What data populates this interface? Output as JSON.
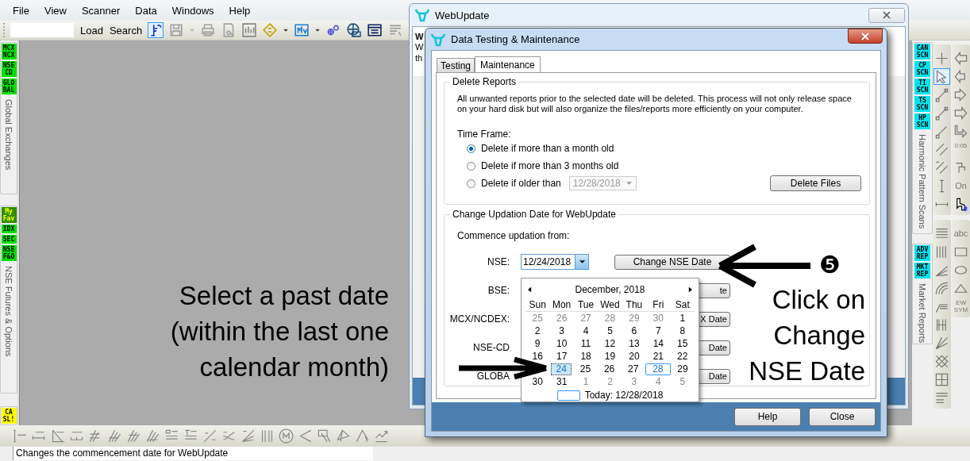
{
  "menu": [
    "File",
    "View",
    "Scanner",
    "Data",
    "Windows",
    "Help"
  ],
  "toolbar": {
    "buttons": [
      "Load",
      "Search"
    ]
  },
  "left_panels": [
    {
      "title": "Global Exchanges",
      "badges": [
        {
          "lines": [
            "MCX",
            "NCX"
          ],
          "color": "#00e000"
        },
        {
          "lines": [
            "NSE",
            "CD"
          ],
          "color": "#00e000"
        },
        {
          "lines": [
            "GLO",
            "BAL"
          ],
          "color": "#00e000"
        }
      ]
    },
    {
      "title": "NSE Futures & Options",
      "badges": [
        {
          "lines": [
            "My",
            "Fav"
          ],
          "color": "#2f8f00"
        },
        {
          "lines": [
            "IDX"
          ],
          "color": "#00e000"
        },
        {
          "lines": [
            "SEC"
          ],
          "color": "#00e000"
        },
        {
          "lines": [
            "NSE",
            "F&O"
          ],
          "color": "#00e000"
        }
      ]
    },
    {
      "badges": [
        {
          "lines": [
            "CA",
            "SL!"
          ],
          "color": "#ffff00"
        }
      ]
    }
  ],
  "right_panels": [
    {
      "title": "Harmonic Pattern Scans",
      "badges": [
        {
          "lines": [
            "CAN",
            "SCN"
          ],
          "color": "#00e5ee"
        },
        {
          "lines": [
            "CP",
            "SCN"
          ],
          "color": "#00e5ee"
        },
        {
          "lines": [
            "TI",
            "SCN"
          ],
          "color": "#00e5ee"
        },
        {
          "lines": [
            "TS",
            "SCN"
          ],
          "color": "#00e5ee"
        },
        {
          "lines": [
            "HP",
            "SCN"
          ],
          "color": "#00e5ee"
        }
      ]
    },
    {
      "title": "Market Reports",
      "badges": [
        {
          "lines": [
            "ADV",
            "REP"
          ],
          "color": "#00e5ee"
        },
        {
          "lines": [
            "MKT",
            "REP"
          ],
          "color": "#00e5ee"
        }
      ]
    }
  ],
  "draw_tools": {
    "time_label": "0:05",
    "on_label": "On",
    "text_label": "abc",
    "wave_label": [
      "EW",
      "SYM"
    ]
  },
  "webupdate": {
    "title": "WebUpdate",
    "heading": "W",
    "lines": [
      "W",
      "th"
    ]
  },
  "dialog": {
    "title": "Data Testing & Maintenance",
    "tabs": [
      {
        "label": "Testing",
        "selected": false
      },
      {
        "label": "Maintenance",
        "selected": true
      }
    ],
    "delete_reports": {
      "title": "Delete Reports",
      "description": "All unwanted reports prior to the selected date will be deleted. This process will not only release space on your hard disk but will also organize the files/reports more efficiently on your computer.",
      "time_frame_label": "Time Frame:",
      "options": [
        {
          "label": "Delete if more than a month old",
          "selected": true
        },
        {
          "label": "Delete if more than 3 months old",
          "selected": false
        },
        {
          "label": "Delete if older than",
          "selected": false
        }
      ],
      "older_than_date": {
        "value": "12/28/2018",
        "disabled": true
      },
      "delete_button": "Delete Files"
    },
    "updation": {
      "title": "Change Updation Date for WebUpdate",
      "intro": "Commence updation from:",
      "rows": [
        {
          "label": "NSE:",
          "value": "12/24/2018",
          "button": "Change NSE Date"
        },
        {
          "label": "BSE:",
          "button": "te"
        },
        {
          "label": "MCX/NCDEX:",
          "button": "X Date"
        },
        {
          "label": "NSE-CD",
          "button": "Date"
        },
        {
          "label": "GLOBA",
          "button": "Date"
        }
      ]
    },
    "calendar": {
      "month": "December, 2018",
      "weekdays": [
        "Sun",
        "Mon",
        "Tue",
        "Wed",
        "Thu",
        "Fri",
        "Sat"
      ],
      "weeks": [
        {
          "days": [
            {
              "day": "25",
              "muted": true,
              "selected": false,
              "today": false
            },
            {
              "day": "26",
              "muted": true,
              "selected": false,
              "today": false
            },
            {
              "day": "27",
              "muted": true,
              "selected": false,
              "today": false
            },
            {
              "day": "28",
              "muted": true,
              "selected": false,
              "today": false
            },
            {
              "day": "29",
              "muted": true,
              "selected": false,
              "today": false
            },
            {
              "day": "30",
              "muted": true,
              "selected": false,
              "today": false
            },
            {
              "day": "1",
              "muted": false,
              "selected": false,
              "today": false
            }
          ]
        },
        {
          "days": [
            {
              "day": "2",
              "muted": false,
              "selected": false,
              "today": false
            },
            {
              "day": "3",
              "muted": false,
              "selected": false,
              "today": false
            },
            {
              "day": "4",
              "muted": false,
              "selected": false,
              "today": false
            },
            {
              "day": "5",
              "muted": false,
              "selected": false,
              "today": false
            },
            {
              "day": "6",
              "muted": false,
              "selected": false,
              "today": false
            },
            {
              "day": "7",
              "muted": false,
              "selected": false,
              "today": false
            },
            {
              "day": "8",
              "muted": false,
              "selected": false,
              "today": false
            }
          ]
        },
        {
          "days": [
            {
              "day": "9",
              "muted": false,
              "selected": false,
              "today": false
            },
            {
              "day": "10",
              "muted": false,
              "selected": false,
              "today": false
            },
            {
              "day": "11",
              "muted": false,
              "selected": false,
              "today": false
            },
            {
              "day": "12",
              "muted": false,
              "selected": false,
              "today": false
            },
            {
              "day": "13",
              "muted": false,
              "selected": false,
              "today": false
            },
            {
              "day": "14",
              "muted": false,
              "selected": false,
              "today": false
            },
            {
              "day": "15",
              "muted": false,
              "selected": false,
              "today": false
            }
          ]
        },
        {
          "days": [
            {
              "day": "16",
              "muted": false,
              "selected": false,
              "today": false
            },
            {
              "day": "17",
              "muted": false,
              "selected": false,
              "today": false
            },
            {
              "day": "18",
              "muted": false,
              "selected": false,
              "today": false
            },
            {
              "day": "19",
              "muted": false,
              "selected": false,
              "today": false
            },
            {
              "day": "20",
              "muted": false,
              "selected": false,
              "today": false
            },
            {
              "day": "21",
              "muted": false,
              "selected": false,
              "today": false
            },
            {
              "day": "22",
              "muted": false,
              "selected": false,
              "today": false
            }
          ]
        },
        {
          "days": [
            {
              "hidden": true
            },
            {
              "day": "24",
              "muted": false,
              "selected": true,
              "today": false
            },
            {
              "day": "25",
              "muted": false,
              "selected": false,
              "today": false
            },
            {
              "day": "26",
              "muted": false,
              "selected": false,
              "today": false
            },
            {
              "day": "27",
              "muted": false,
              "selected": false,
              "today": false
            },
            {
              "day": "28",
              "muted": false,
              "selected": false,
              "today": true
            },
            {
              "day": "29",
              "muted": false,
              "selected": false,
              "today": false
            }
          ]
        },
        {
          "days": [
            {
              "day": "30",
              "muted": false,
              "selected": false,
              "today": false
            },
            {
              "day": "31",
              "muted": false,
              "selected": false,
              "today": false
            },
            {
              "day": "1",
              "muted": true,
              "selected": false,
              "today": false
            },
            {
              "day": "2",
              "muted": true,
              "selected": false,
              "today": false
            },
            {
              "day": "3",
              "muted": true,
              "selected": false,
              "today": false
            },
            {
              "day": "4",
              "muted": true,
              "selected": false,
              "today": false
            },
            {
              "day": "5",
              "muted": true,
              "selected": false,
              "today": false
            }
          ]
        }
      ],
      "today_label": "Today: 12/28/2018"
    },
    "buttons": [
      "Help",
      "Close"
    ]
  },
  "annotations": {
    "left_lines": [
      "Select a past date",
      "(within the last one",
      "calendar month)"
    ],
    "step": "❺",
    "right_lines": [
      "Click on",
      "Change",
      "NSE Date"
    ]
  },
  "status_bar": "Changes the commencement date for WebUpdate"
}
